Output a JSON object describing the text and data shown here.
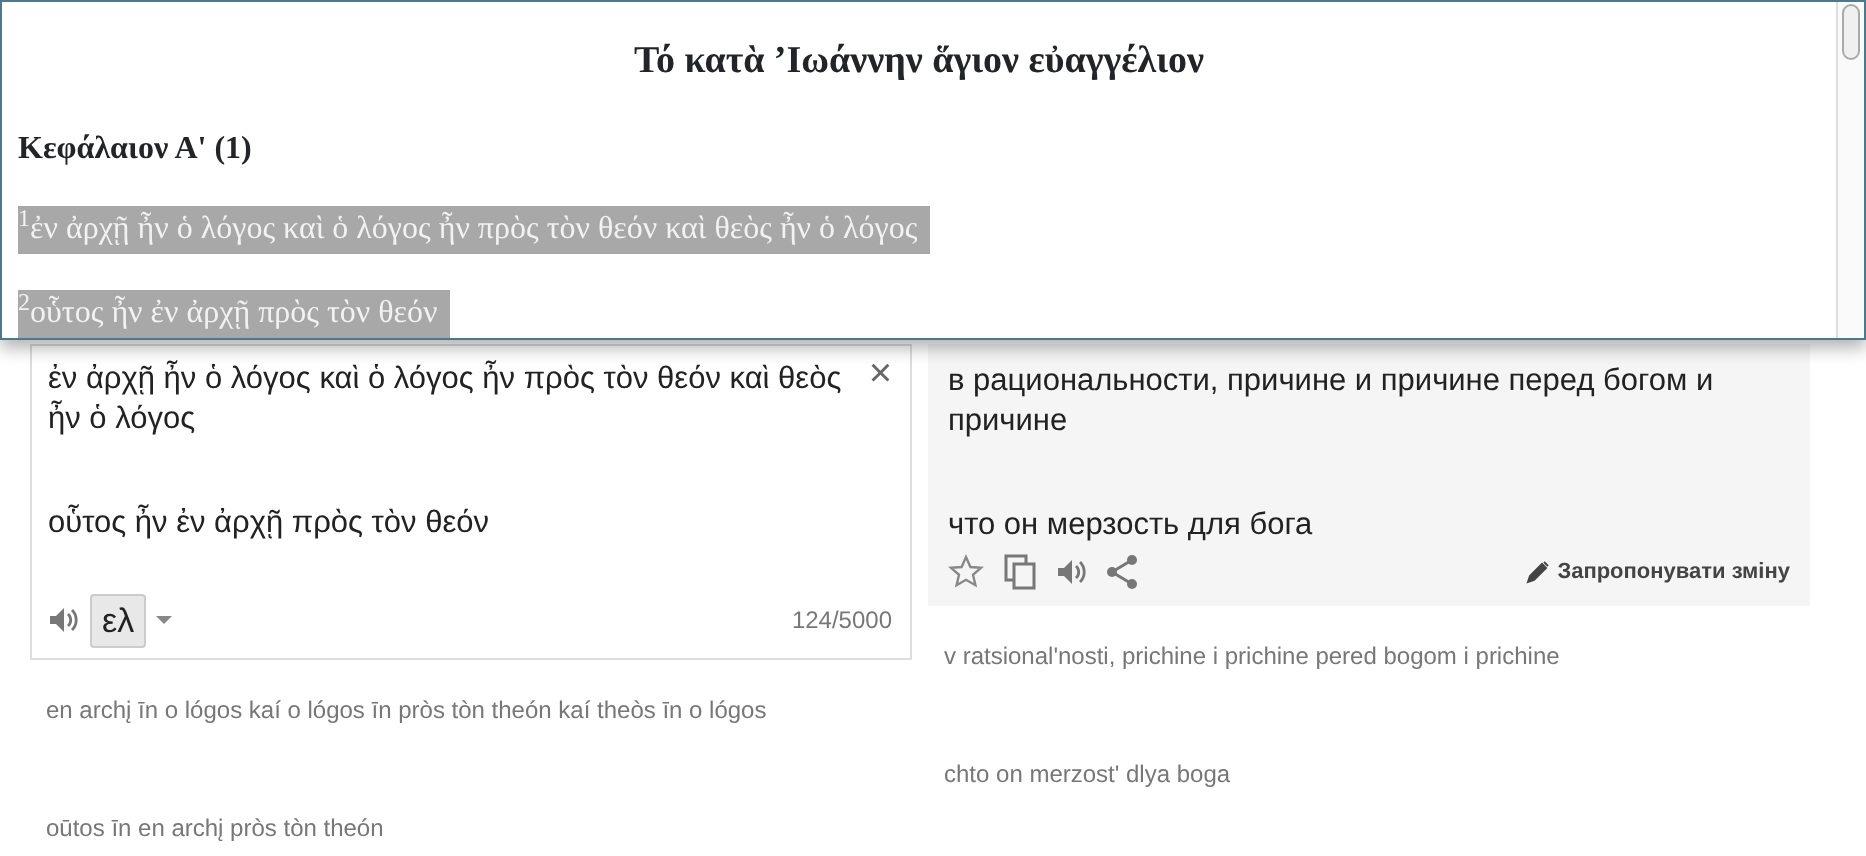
{
  "document": {
    "title": "Τό κατὰ ’Ιωάννην ἅγιον εὐαγγέλιον",
    "chapter": "Κεφάλαιον Α' (1)",
    "verses": [
      {
        "number": "1",
        "text": "ἐν ἀρχῇ ἦν ὁ λόγος καὶ ὁ λόγος ἦν πρὸς τὸν θεόν καὶ θεὸς ἦν ὁ λόγος",
        "selected": true
      },
      {
        "number": "2",
        "text": "οὗτος ἦν ἐν ἀρχῇ πρὸς τὸν θεόν",
        "selected": true
      }
    ]
  },
  "source": {
    "paragraphs": [
      "ἐν ἀρχῇ ἦν ὁ λόγος καὶ ὁ λόγος ἦν πρὸς τὸν θεόν καὶ θεὸς ἦν ὁ λόγος",
      "οὗτος ἦν ἐν ἀρχῇ πρὸς τὸν θεόν"
    ],
    "clear": "×",
    "language": "ελ",
    "char_count": "124/5000"
  },
  "source_transliteration": [
    "en archį īn o lógos kaí o lógos īn pròs tòn theón kaí theòs īn o lógos",
    "oūtos īn en archį pròs tòn theón"
  ],
  "translation": {
    "paragraphs": [
      "в рациональности, причине и причине перед богом и причине",
      "что он мерзость для бога"
    ],
    "suggest": "Запропонувати зміну"
  },
  "translation_transliteration": [
    "v ratsional'nosti, prichine i prichine pered bogom i prichine",
    "chto on merzost' dlya boga"
  ]
}
